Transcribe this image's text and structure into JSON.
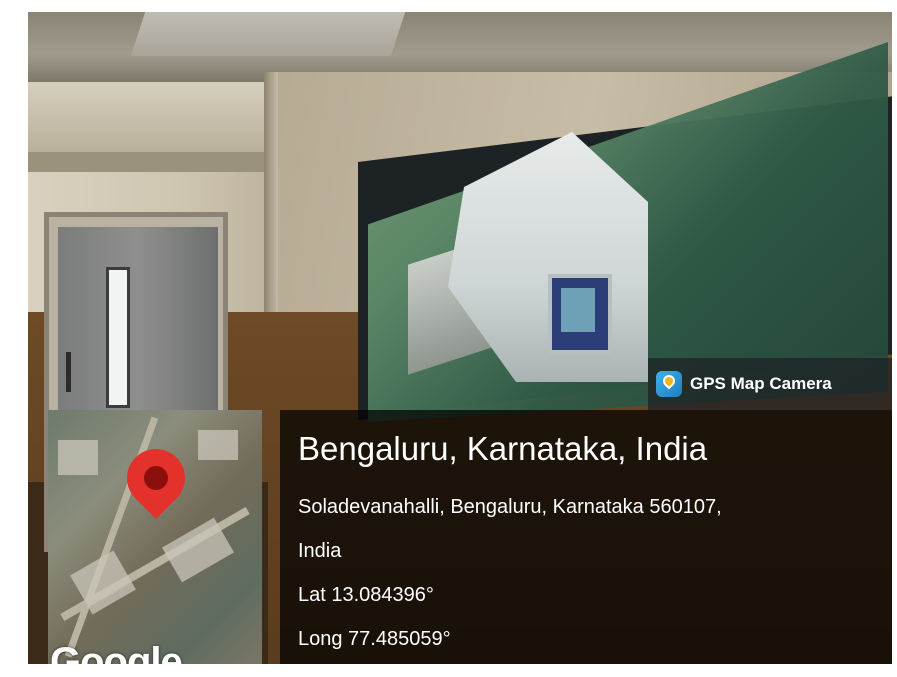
{
  "overlay": {
    "app_badge": "GPS Map Camera",
    "location_title": "Bengaluru, Karnataka, India",
    "address_line1": "Soladevanahalli, Bengaluru, Karnataka 560107,",
    "address_line2": "India",
    "latitude": "Lat 13.084396°",
    "longitude": "Long 77.485059°",
    "map_attribution": "Google"
  },
  "icons": {
    "badge_icon": "gps-map-camera-icon",
    "map_pin": "location-pin-icon"
  },
  "colors": {
    "pin": "#e3322c",
    "overlay_bg": "#000000",
    "text": "#ffffff"
  }
}
